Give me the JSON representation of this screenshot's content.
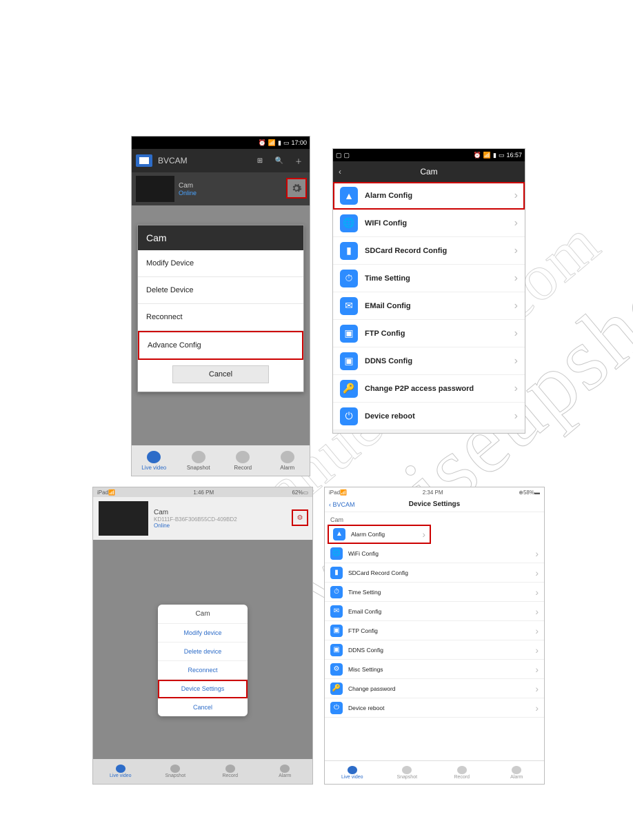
{
  "watermarks": {
    "primary": "www.wiseupshop.com",
    "secondary": "manuelshop.com"
  },
  "screenshot1": {
    "status_time": "17:00",
    "app_title": "BVCAM",
    "device_name": "Cam",
    "device_status": "Online",
    "modal_title": "Cam",
    "modal_items": [
      "Modify Device",
      "Delete Device",
      "Reconnect",
      "Advance Config"
    ],
    "modal_cancel": "Cancel",
    "tabs": [
      "Live video",
      "Snapshot",
      "Record",
      "Alarm"
    ]
  },
  "screenshot2": {
    "status_time": "16:57",
    "header_title": "Cam",
    "rows": [
      "Alarm Config",
      "WIFI Config",
      "SDCard Record Config",
      "Time Setting",
      "EMail Config",
      "FTP Config",
      "DDNS Config",
      "Change P2P access password",
      "Device reboot"
    ]
  },
  "screenshot3": {
    "status_left": "iPad",
    "status_time": "1:46 PM",
    "status_right": "62%",
    "device_name": "Cam",
    "device_id": "KD111F-B36F306B55CD-409BD2",
    "device_status": "Online",
    "popup_title": "Cam",
    "popup_items": [
      "Modify device",
      "Delete device",
      "Reconnect",
      "Device Settings"
    ],
    "popup_cancel": "Cancel",
    "tabs": [
      "Live video",
      "Snapshot",
      "Record",
      "Alarm"
    ]
  },
  "screenshot4": {
    "status_left": "iPad",
    "status_time": "2:34 PM",
    "status_right": "58%",
    "nav_back": "BVCAM",
    "nav_title": "Device Settings",
    "section": "Cam",
    "rows": [
      "Alarm Config",
      "WiFi Config",
      "SDCard Record Config",
      "Time Setting",
      "Email Config",
      "FTP Config",
      "DDNS Config",
      "Misc Settings",
      "Change password",
      "Device reboot"
    ],
    "tabs": [
      "Live video",
      "Snapshot",
      "Record",
      "Alarm"
    ]
  }
}
